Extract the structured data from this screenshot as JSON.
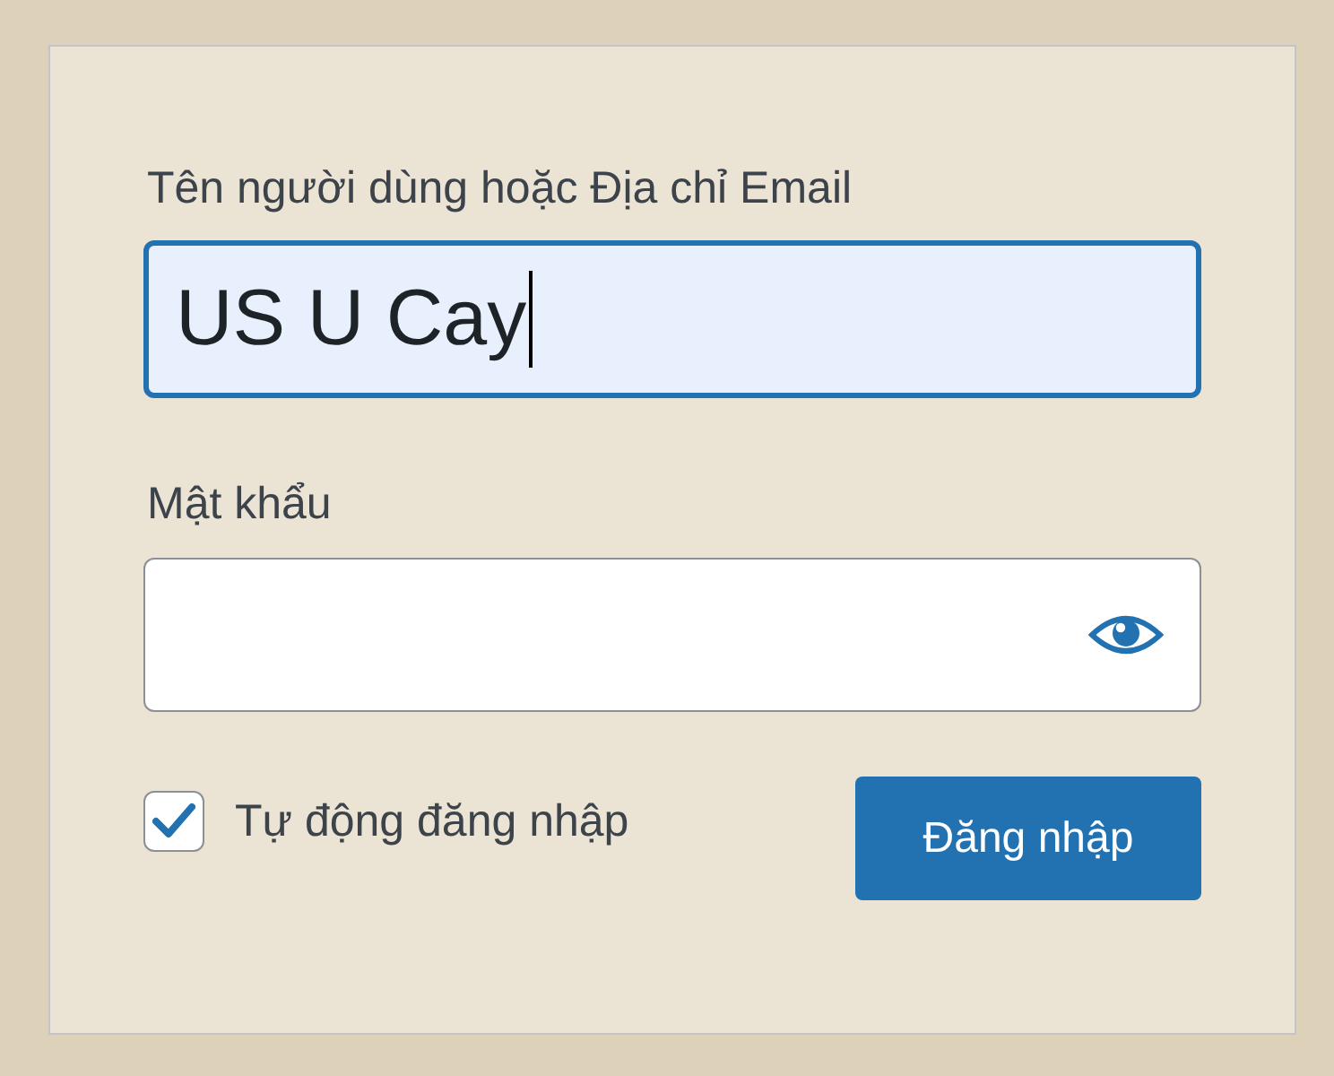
{
  "fields": [
    {
      "kind": "text",
      "label": "Tên người dùng hoặc Địa chỉ Email",
      "value": "US U Cay",
      "focused": true
    },
    {
      "kind": "password",
      "label": "Mật khẩu",
      "focused": false
    }
  ],
  "remember": {
    "label": "Tự động đăng nhập",
    "checked": true
  },
  "submit_button": {
    "label": "Đăng nhập"
  }
}
